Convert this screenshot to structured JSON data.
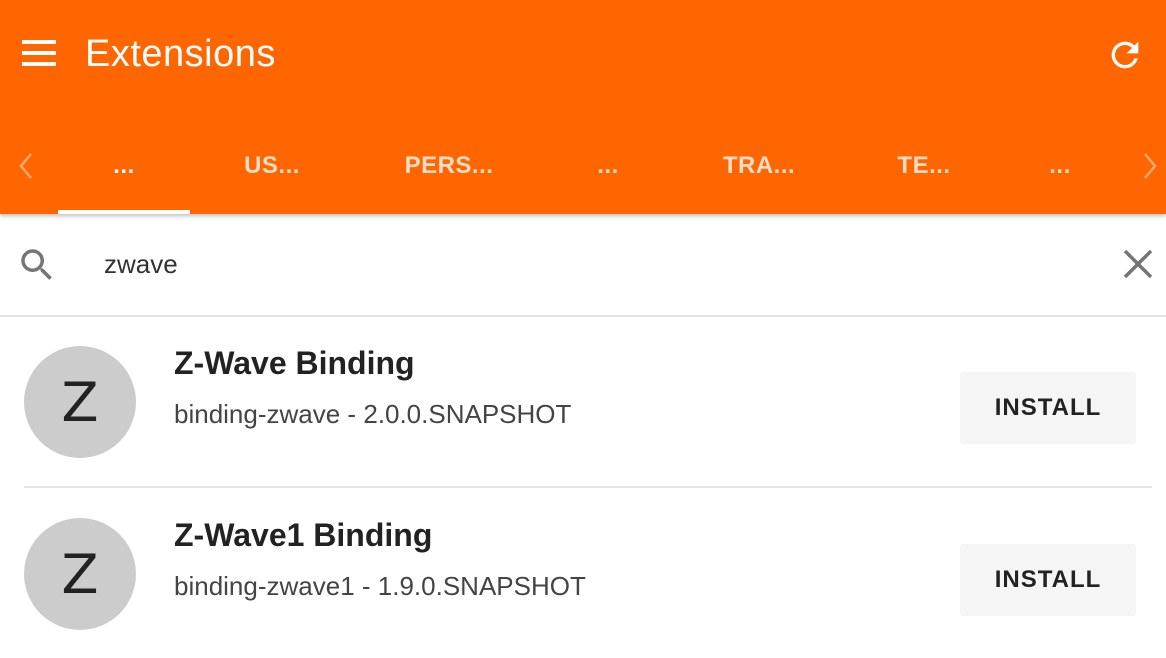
{
  "header": {
    "title": "Extensions",
    "background_color": "#ff6600",
    "menu_icon": "hamburger-menu-icon",
    "refresh_icon": "refresh-icon"
  },
  "tabs": {
    "items": [
      {
        "label": "...",
        "active": true
      },
      {
        "label": "US...",
        "active": false
      },
      {
        "label": "PERS...",
        "active": false
      },
      {
        "label": "...",
        "active": false
      },
      {
        "label": "TRA...",
        "active": false
      },
      {
        "label": "TE...",
        "active": false
      },
      {
        "label": "...",
        "active": false
      }
    ],
    "left_arrow_icon": "chevron-left-icon",
    "right_arrow_icon": "chevron-right-icon"
  },
  "search": {
    "value": "zwave",
    "search_icon": "search-icon",
    "clear_icon": "close-icon"
  },
  "extensions": [
    {
      "avatar_letter": "Z",
      "name": "Z-Wave Binding",
      "subtitle": "binding-zwave - 2.0.0.SNAPSHOT",
      "action_label": "INSTALL"
    },
    {
      "avatar_letter": "Z",
      "name": "Z-Wave1 Binding",
      "subtitle": "binding-zwave1 - 1.9.0.SNAPSHOT",
      "action_label": "INSTALL"
    }
  ]
}
